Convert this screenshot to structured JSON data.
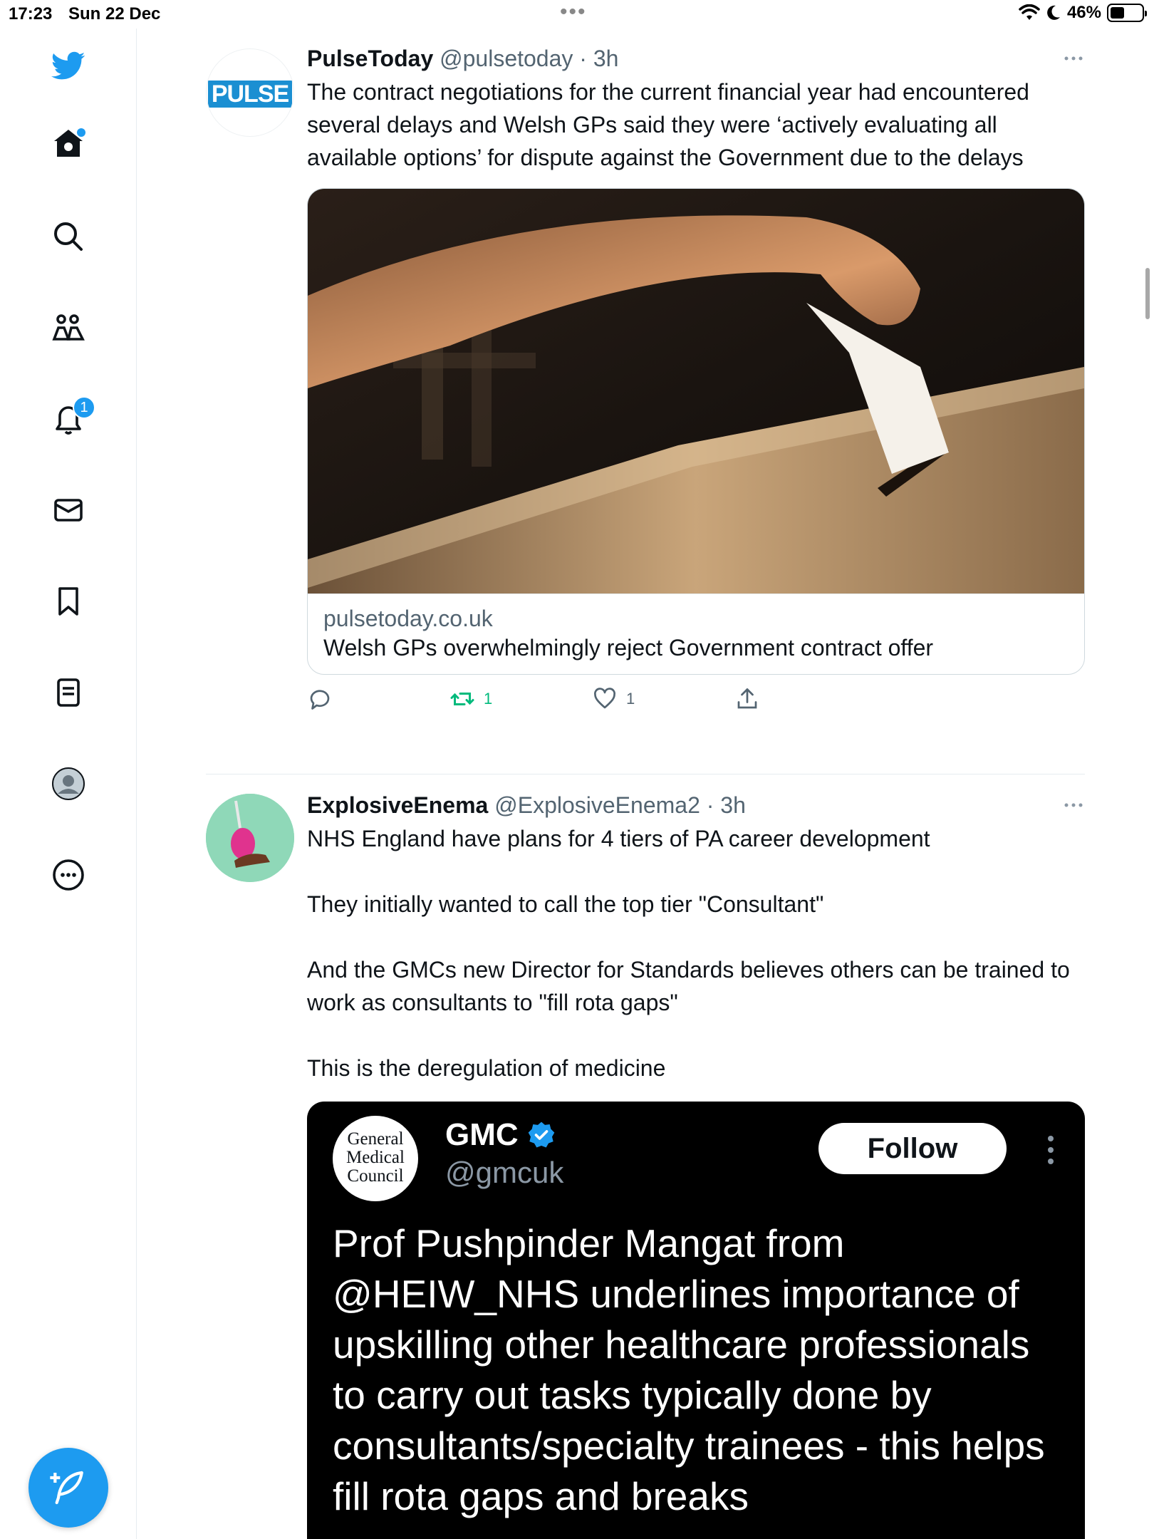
{
  "status_bar": {
    "time": "17:23",
    "date": "Sun 22 Dec",
    "battery": "46%",
    "battery_level": 0.46
  },
  "sidebar": {
    "items": [
      {
        "icon": "twitter-bird-icon"
      },
      {
        "icon": "home-icon",
        "has_dot": true
      },
      {
        "icon": "search-icon"
      },
      {
        "icon": "communities-icon"
      },
      {
        "icon": "bell-icon",
        "badge": "1"
      },
      {
        "icon": "mail-icon"
      },
      {
        "icon": "bookmark-icon"
      },
      {
        "icon": "lists-icon"
      },
      {
        "icon": "profile-icon"
      },
      {
        "icon": "more-circle-icon"
      }
    ],
    "compose_icon": "compose-feather-icon"
  },
  "tweets": [
    {
      "name": "PulseToday",
      "handle": "@pulsetoday",
      "sep": " · ",
      "time": "3h",
      "avatar_text": "PULSE",
      "text": "The contract negotiations for the current financial year had encountered several delays and Welsh GPs said they were ‘actively evaluating all available options’ for dispute against the Government due to the delays",
      "card": {
        "domain": "pulsetoday.co.uk",
        "title": "Welsh GPs overwhelmingly reject Government contract offer"
      },
      "actions": {
        "reply": "",
        "retweet": "1",
        "like": "1"
      },
      "colors": {
        "retweet": "#00ba7c"
      }
    },
    {
      "name": "ExplosiveEnema",
      "handle": "@ExplosiveEnema2",
      "sep": " · ",
      "time": "3h",
      "text_lines": [
        "NHS England have plans for 4 tiers of PA career development",
        "They initially wanted to call the top tier \"Consultant\"",
        "And the GMCs new Director for Standards believes others can be trained to work as consultants to \"fill rota gaps\"",
        "This is the deregulation of medicine"
      ],
      "embedded": {
        "logo_lines": [
          "General",
          "Medical",
          "Council"
        ],
        "name": "GMC",
        "handle": "@gmcuk",
        "follow": "Follow",
        "text": "Prof Pushpinder Mangat from @HEIW_NHS underlines importance of upskilling other healthcare professionals to carry out tasks typically done by consultants/specialty trainees - this helps fill rota gaps and breaks"
      }
    }
  ]
}
